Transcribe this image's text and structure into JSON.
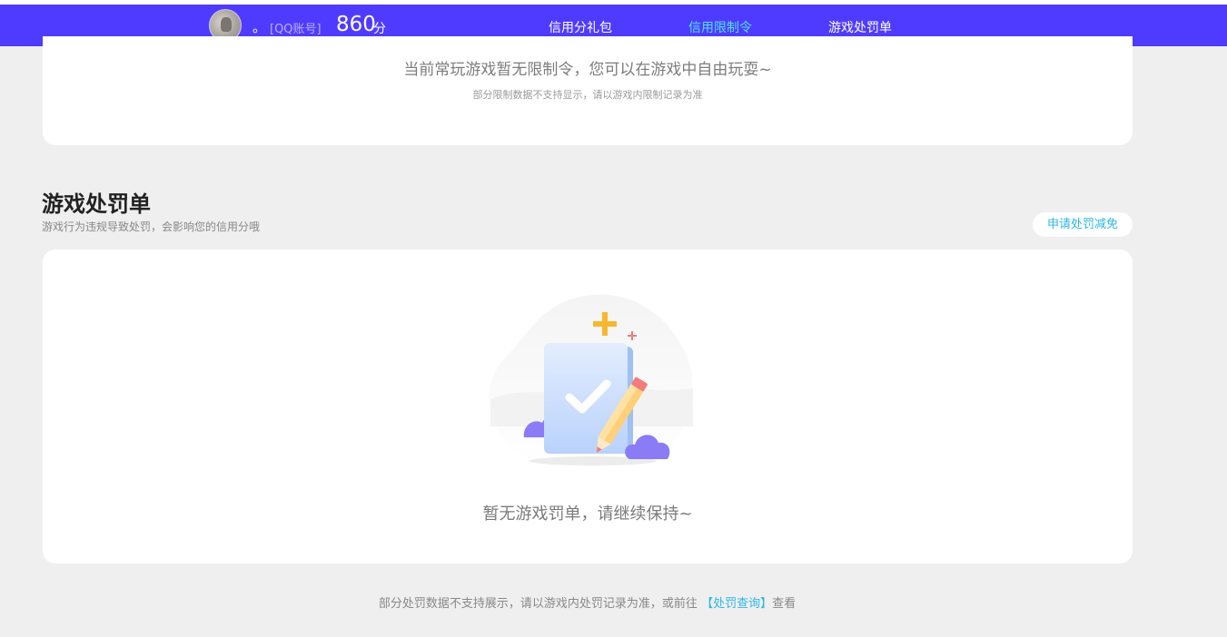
{
  "header": {
    "nickname": "。",
    "account_label": "[QQ账号]",
    "score": "860",
    "score_unit": "分",
    "nav": [
      {
        "label": "信用分礼包"
      },
      {
        "label": "信用限制令"
      },
      {
        "label": "游戏处罚单"
      }
    ]
  },
  "restrictions": {
    "message": "当前常玩游戏暂无限制令，您可以在游戏中自由玩耍~",
    "note": "部分限制数据不支持显示，请以游戏内限制记录为准"
  },
  "penalties": {
    "title": "游戏处罚单",
    "description": "游戏行为违规导致处罚，会影响您的信用分哦",
    "apply_button": "申请处罚减免",
    "empty_message": "暂无游戏罚单，请继续保持~"
  },
  "footer": {
    "text_before": "部分处罚数据不支持展示，请以游戏内处罚记录为准，或前往",
    "link": "【处罚查询】",
    "text_after": "查看"
  },
  "colors": {
    "brand": "#4f3bff",
    "nav_active": "#51e3ff",
    "link": "#2cb7e6"
  }
}
